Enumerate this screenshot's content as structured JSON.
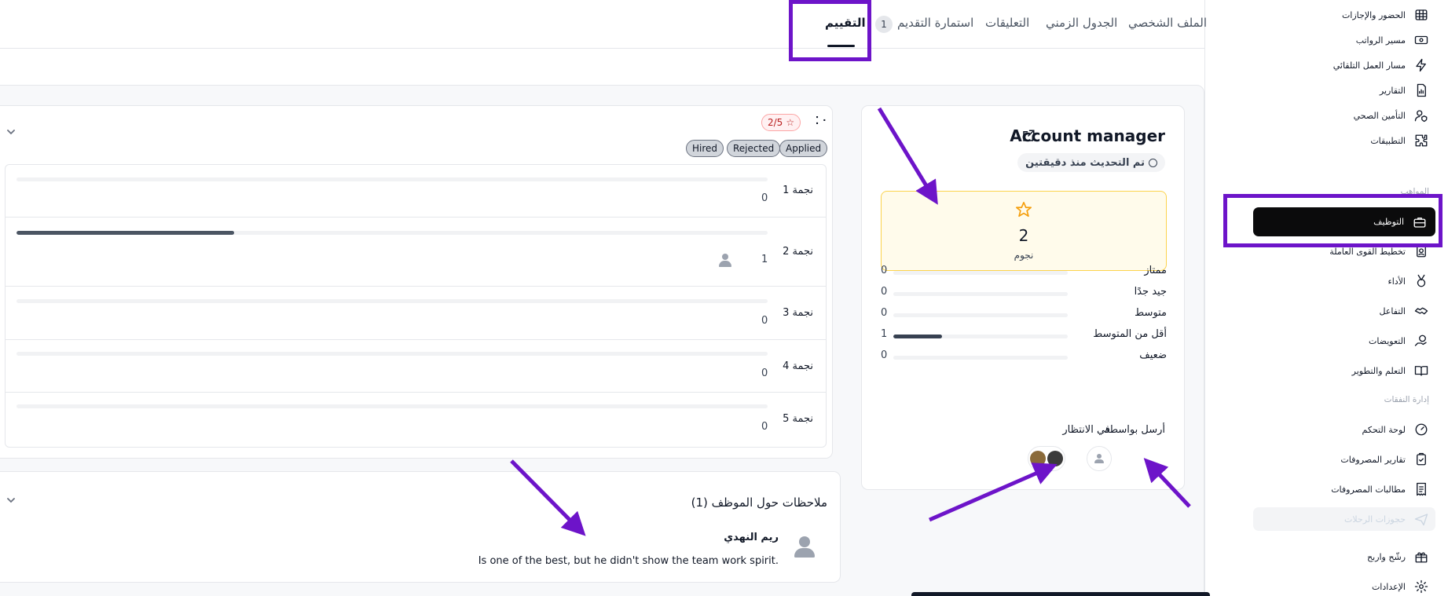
{
  "tabs": {
    "profile": "الملف الشخصي",
    "timeline": "الجدول الزمني",
    "comments": "التعليقات",
    "application_form": "استمارة التقديم",
    "application_form_count": "1",
    "evaluation": "التقييم"
  },
  "sidebar": {
    "items": [
      {
        "label": "الحضور والإجازات",
        "icon": "table-icon"
      },
      {
        "label": "مسير الرواتب",
        "icon": "cash-icon"
      },
      {
        "label": "مسار العمل التلقائي",
        "icon": "automation-icon"
      },
      {
        "label": "التقارير",
        "icon": "report-icon"
      },
      {
        "label": "التأمين الصحي",
        "icon": "insurance-icon"
      },
      {
        "label": "التطبيقات",
        "icon": "puzzle-icon"
      }
    ],
    "section_hidden": "المواهب",
    "active_item": {
      "label": "التوظيف",
      "icon": "briefcase-icon"
    },
    "items2": [
      {
        "label": "تخطيط القوى العاملة",
        "icon": "badge-icon"
      },
      {
        "label": "الأداء",
        "icon": "medal-icon"
      },
      {
        "label": "التفاعل",
        "icon": "handshake-icon"
      },
      {
        "label": "التعويضات",
        "icon": "coins-icon"
      },
      {
        "label": "التعلم والتطوير",
        "icon": "book-icon"
      }
    ],
    "section_expenses": "إدارة النفقات",
    "items3": [
      {
        "label": "لوحة التحكم",
        "icon": "dashboard-icon"
      },
      {
        "label": "تقارير المصروفات",
        "icon": "clipboard-icon"
      },
      {
        "label": "مطالبات المصروفات",
        "icon": "receipt-icon"
      }
    ],
    "disabled_item": {
      "label": "حجوزات الرحلات",
      "icon": "plane-icon"
    },
    "items4": [
      {
        "label": "رشّح واربح",
        "icon": "gift-icon"
      },
      {
        "label": "الإعدادات",
        "icon": "gear-icon"
      }
    ]
  },
  "account": {
    "title": "Account manager",
    "updated": "تم التحديث منذ دقيقتين",
    "stars_value": "2",
    "stars_label": "نجوم",
    "distribution": [
      {
        "label": "ممتاز",
        "count": "0",
        "fraction": 0
      },
      {
        "label": "جيد جدًا",
        "count": "0",
        "fraction": 0
      },
      {
        "label": "متوسط",
        "count": "0",
        "fraction": 0
      },
      {
        "label": "أقل من المتوسط",
        "count": "1",
        "fraction": 0.28
      },
      {
        "label": "ضعيف",
        "count": "0",
        "fraction": 0
      }
    ],
    "sent_by_label": "أرسل بواسطة",
    "pending_label": "في الانتظار"
  },
  "ratings": {
    "badge": "2/5",
    "chips": [
      "Applied",
      "Rejected",
      "Hired"
    ],
    "rows": [
      {
        "label": "1 نجمة",
        "count": "0",
        "fraction": 0
      },
      {
        "label": "2 نجمة",
        "count": "1",
        "fraction": 0.29
      },
      {
        "label": "3 نجمة",
        "count": "0",
        "fraction": 0
      },
      {
        "label": "4 نجمة",
        "count": "0",
        "fraction": 0
      },
      {
        "label": "5 نجمة",
        "count": "0",
        "fraction": 0
      }
    ]
  },
  "notes": {
    "title": "ملاحظات حول الموظف (1)",
    "author": "ريم النهدي",
    "text": "Is one of the best, but he didn't show the team work spirit."
  },
  "colors": {
    "highlight": "#6d14c9",
    "active_bg": "#0b0b0c",
    "star": "#f59e0b",
    "badge_red": "#b91c1c"
  }
}
